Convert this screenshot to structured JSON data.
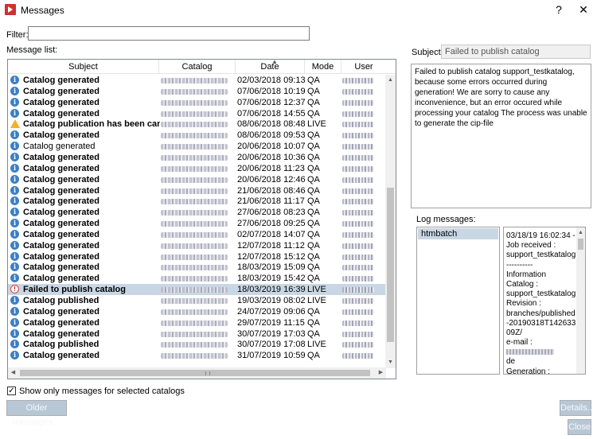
{
  "window": {
    "title": "Messages",
    "help_label": "?",
    "close_label": "✕"
  },
  "filter": {
    "label": "Filter:",
    "value": "",
    "placeholder": ""
  },
  "message_list": {
    "label": "Message list:",
    "columns": [
      "Subject",
      "Catalog",
      "Date",
      "Mode",
      "User"
    ],
    "rows": [
      {
        "icon": "info-icon",
        "subject": "Catalog generated",
        "bold": true,
        "date": "02/03/2018 09:13",
        "mode": "QA"
      },
      {
        "icon": "info-icon",
        "subject": "Catalog generated",
        "bold": true,
        "date": "07/06/2018 10:19",
        "mode": "QA"
      },
      {
        "icon": "info-icon",
        "subject": "Catalog generated",
        "bold": true,
        "date": "07/06/2018 12:37",
        "mode": "QA"
      },
      {
        "icon": "info-icon",
        "subject": "Catalog generated",
        "bold": true,
        "date": "07/06/2018 14:55",
        "mode": "QA"
      },
      {
        "icon": "warning-icon",
        "subject": "Catalog publication has been cancelled",
        "bold": true,
        "date": "08/06/2018 08:48",
        "mode": "LIVE"
      },
      {
        "icon": "info-icon",
        "subject": "Catalog generated",
        "bold": true,
        "date": "08/06/2018 09:53",
        "mode": "QA"
      },
      {
        "icon": "info-icon",
        "subject": "Catalog generated",
        "bold": false,
        "date": "20/06/2018 10:07",
        "mode": "QA"
      },
      {
        "icon": "info-icon",
        "subject": "Catalog generated",
        "bold": true,
        "date": "20/06/2018 10:36",
        "mode": "QA"
      },
      {
        "icon": "info-icon",
        "subject": "Catalog generated",
        "bold": true,
        "date": "20/06/2018 11:23",
        "mode": "QA"
      },
      {
        "icon": "info-icon",
        "subject": "Catalog generated",
        "bold": true,
        "date": "20/06/2018 12:46",
        "mode": "QA"
      },
      {
        "icon": "info-icon",
        "subject": "Catalog generated",
        "bold": true,
        "date": "21/06/2018 08:46",
        "mode": "QA"
      },
      {
        "icon": "info-icon",
        "subject": "Catalog generated",
        "bold": true,
        "date": "21/06/2018 11:17",
        "mode": "QA"
      },
      {
        "icon": "info-icon",
        "subject": "Catalog generated",
        "bold": true,
        "date": "27/06/2018 08:23",
        "mode": "QA"
      },
      {
        "icon": "info-icon",
        "subject": "Catalog generated",
        "bold": true,
        "date": "27/06/2018 09:25",
        "mode": "QA"
      },
      {
        "icon": "info-icon",
        "subject": "Catalog generated",
        "bold": true,
        "date": "02/07/2018 14:07",
        "mode": "QA"
      },
      {
        "icon": "info-icon",
        "subject": "Catalog generated",
        "bold": true,
        "date": "12/07/2018 11:12",
        "mode": "QA"
      },
      {
        "icon": "info-icon",
        "subject": "Catalog generated",
        "bold": true,
        "date": "12/07/2018 15:12",
        "mode": "QA"
      },
      {
        "icon": "info-icon",
        "subject": "Catalog generated",
        "bold": true,
        "date": "18/03/2019 15:09",
        "mode": "QA"
      },
      {
        "icon": "info-icon",
        "subject": "Catalog generated",
        "bold": true,
        "date": "18/03/2019 15:42",
        "mode": "QA"
      },
      {
        "icon": "error-icon",
        "subject": "Failed to publish catalog",
        "bold": true,
        "date": "18/03/2019 16:39",
        "mode": "LIVE",
        "selected": true
      },
      {
        "icon": "info-icon",
        "subject": "Catalog published",
        "bold": true,
        "date": "19/03/2019 08:02",
        "mode": "LIVE"
      },
      {
        "icon": "info-icon",
        "subject": "Catalog generated",
        "bold": true,
        "date": "24/07/2019 09:06",
        "mode": "QA"
      },
      {
        "icon": "info-icon",
        "subject": "Catalog generated",
        "bold": true,
        "date": "29/07/2019 11:15",
        "mode": "QA"
      },
      {
        "icon": "info-icon",
        "subject": "Catalog generated",
        "bold": true,
        "date": "30/07/2019 17:03",
        "mode": "QA"
      },
      {
        "icon": "info-icon",
        "subject": "Catalog published",
        "bold": true,
        "date": "30/07/2019 17:08",
        "mode": "LIVE"
      },
      {
        "icon": "info-icon",
        "subject": "Catalog generated",
        "bold": true,
        "date": "31/07/2019 10:59",
        "mode": "QA"
      }
    ]
  },
  "options": {
    "show_selected_label": "Show only messages for selected catalogs",
    "show_selected_checked": true
  },
  "buttons": {
    "older": "Older messages...",
    "details": "Details...",
    "close": "Close"
  },
  "subject": {
    "label": "Subject:",
    "value": "Failed to publish catalog"
  },
  "message_body": "Failed to publish catalog support_testkatalog, because some errors occurred during generation! We are sorry to cause any inconvenience, but an error occured while processing your catalog The process was unable to generate the cip-file",
  "log": {
    "label": "Log messages:",
    "items": [
      "htmbatch"
    ],
    "detail_lines": [
      "03/18/19 16:02:34 -",
      "Job received :",
      "support_testkatalog",
      "----------",
      "Information",
      "Catalog        :",
      "support_testkatalog",
      "Revision       :",
      "branches/published",
      "-20190318T142633.7",
      "09Z/",
      "e-mail         :",
      "",
      "de",
      "Generation     :"
    ]
  }
}
